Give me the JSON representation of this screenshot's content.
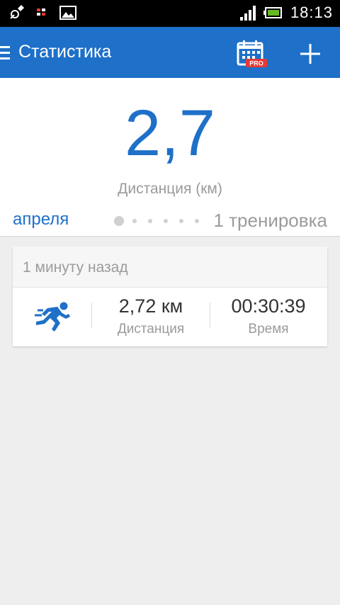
{
  "status_bar": {
    "time": "18:13",
    "icons": [
      "gps-icon",
      "sim-icon",
      "image-icon",
      "signal-icon",
      "battery-icon"
    ]
  },
  "app_bar": {
    "title": "Статистика",
    "pro_badge": "PRO",
    "icons": [
      "menu-icon",
      "calendar-icon",
      "add-icon"
    ],
    "color": "#1e70c8"
  },
  "summary": {
    "value": "2,7",
    "label": "Дистанция (км)",
    "period_left": "апреля",
    "period_right": "1 тренировка"
  },
  "activity": {
    "time_ago": "1 минуту назад",
    "icon": "running-icon",
    "distance_value": "2,72 км",
    "distance_label": "Дистанция",
    "duration_value": "00:30:39",
    "duration_label": "Время"
  }
}
